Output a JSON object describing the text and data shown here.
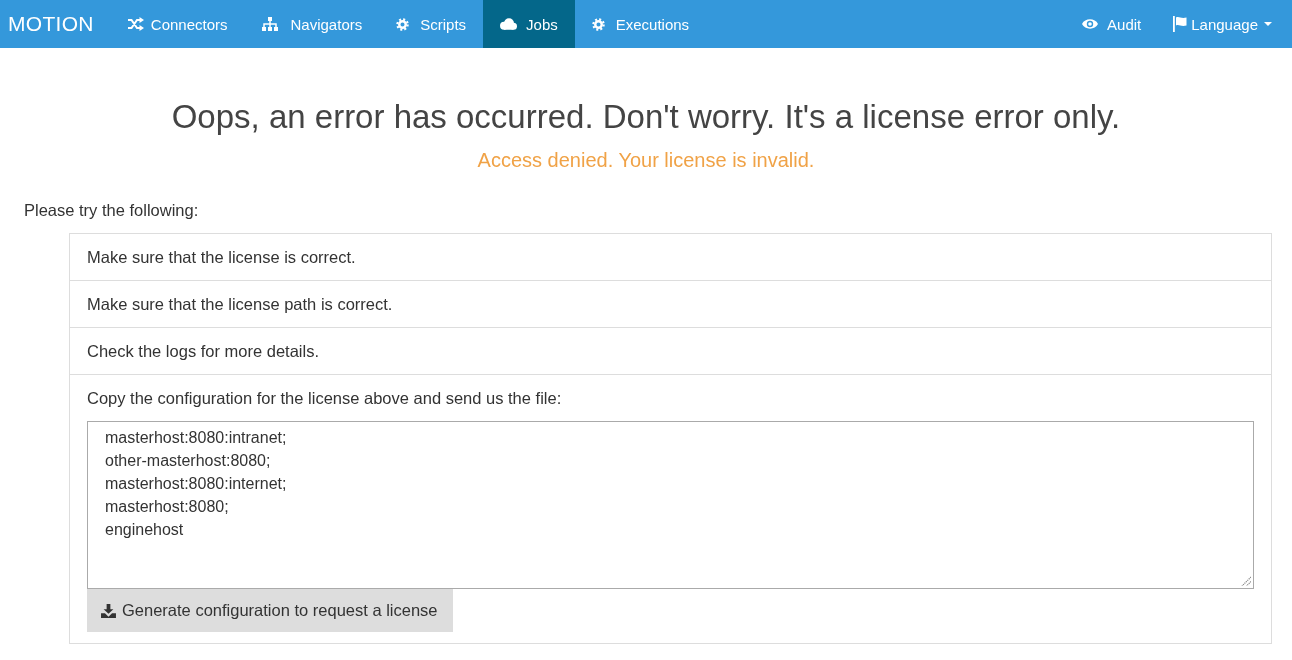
{
  "navbar": {
    "brand": "MOTION",
    "items": [
      {
        "label": "Connectors",
        "selected": false
      },
      {
        "label": "Navigators",
        "selected": false
      },
      {
        "label": "Scripts",
        "selected": false
      },
      {
        "label": "Jobs",
        "selected": true
      },
      {
        "label": "Executions",
        "selected": false
      }
    ],
    "right_items": [
      {
        "label": "Audit",
        "dropdown": false
      },
      {
        "label": "Language",
        "dropdown": true
      }
    ]
  },
  "error": {
    "title": "Oops, an error has occurred. Don't worry. It's a license error only.",
    "subtitle": "Access denied. Your license is invalid."
  },
  "help": {
    "intro": "Please try the following:",
    "steps": [
      {
        "kind": "text",
        "text": "Make sure that the license is correct."
      },
      {
        "kind": "text",
        "text": "Make sure that the license path is correct."
      },
      {
        "kind": "text",
        "text": "Check the logs for more details."
      },
      {
        "kind": "config",
        "text": "Copy the configuration for the license above and send us the file:",
        "value": "masterhost:8080:intranet;\nother-masterhost:8080;\nmasterhost:8080:internet;\nmasterhost:8080;\nenginehost",
        "button": "Generate configuration to request a license"
      }
    ]
  }
}
